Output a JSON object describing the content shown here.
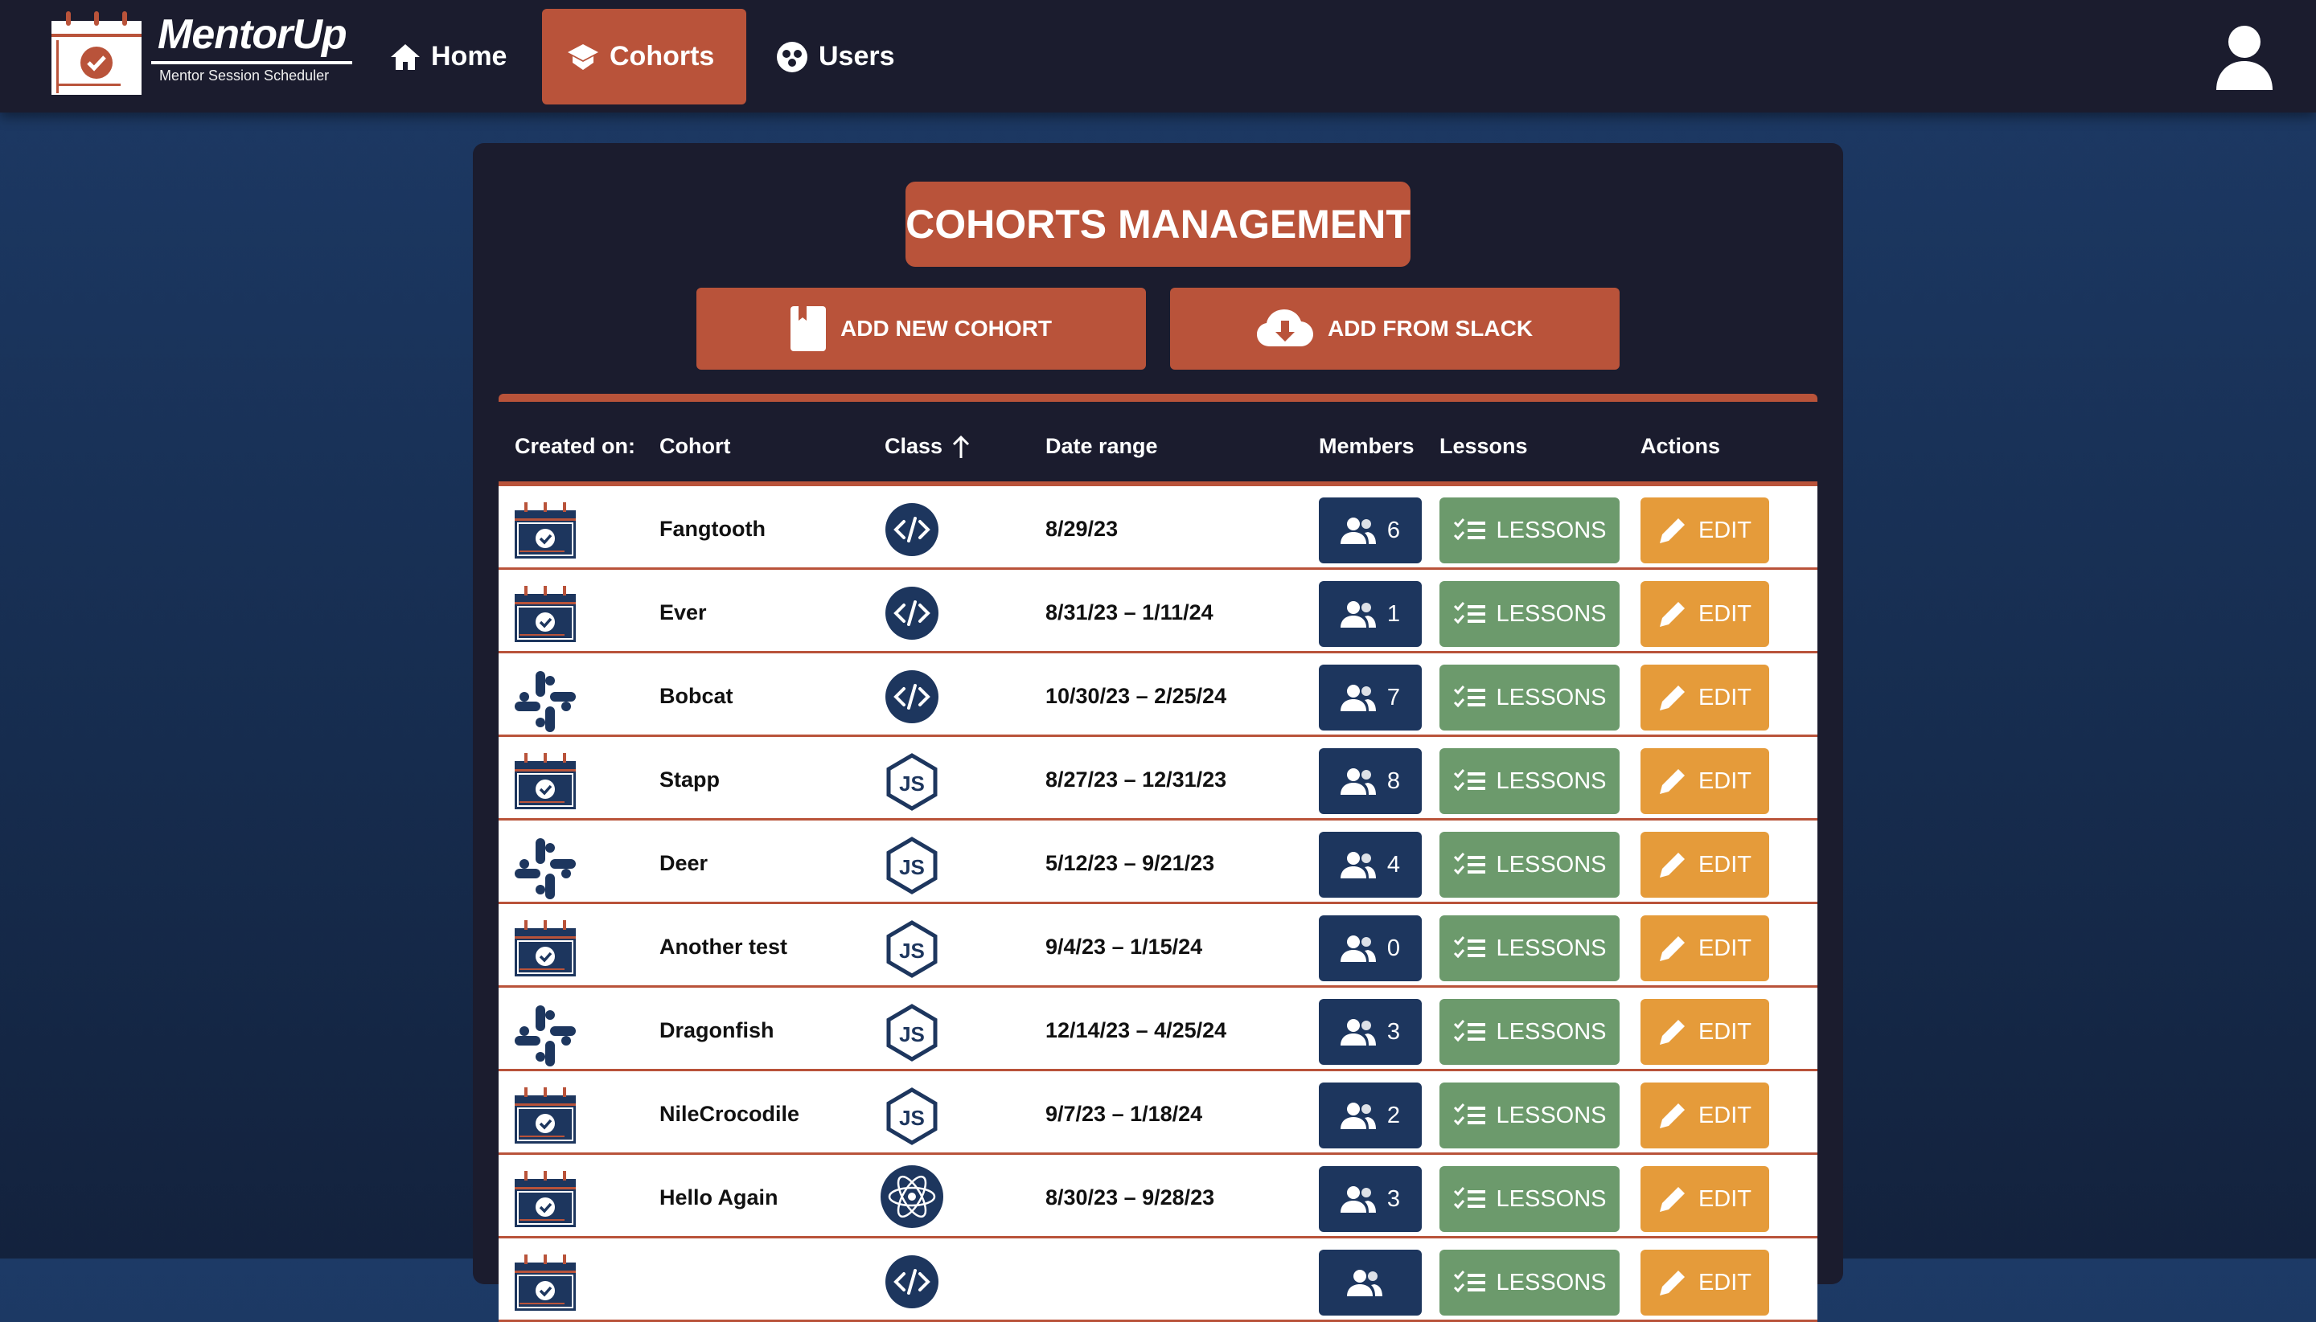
{
  "nav": {
    "brand": "MentorUp",
    "tagline": "Mentor Session Scheduler",
    "items": [
      {
        "label": "Home",
        "icon": "home-icon"
      },
      {
        "label": "Cohorts",
        "icon": "graduation-cap-icon",
        "active": true
      },
      {
        "label": "Users",
        "icon": "users-circle-icon"
      }
    ]
  },
  "page": {
    "title": "COHORTS MANAGEMENT",
    "add_new": "ADD NEW COHORT",
    "add_slack": "ADD FROM SLACK"
  },
  "table": {
    "headers": {
      "created": "Created on:",
      "cohort": "Cohort",
      "class": "Class",
      "date": "Date range",
      "members": "Members",
      "lessons": "Lessons",
      "actions": "Actions"
    },
    "sort": {
      "column": "Class",
      "direction": "ascending"
    },
    "lessons_label": "LESSONS",
    "edit_label": "EDIT",
    "rows": [
      {
        "source": "calendar",
        "name": "Fangtooth",
        "class": "code",
        "date": "8/29/23",
        "members": "6"
      },
      {
        "source": "calendar",
        "name": "Ever",
        "class": "code",
        "date": "8/31/23 – 1/11/24",
        "members": "1"
      },
      {
        "source": "slack",
        "name": "Bobcat",
        "class": "code",
        "date": "10/30/23 – 2/25/24",
        "members": "7"
      },
      {
        "source": "calendar",
        "name": "Stapp",
        "class": "node",
        "date": "8/27/23 – 12/31/23",
        "members": "8"
      },
      {
        "source": "slack",
        "name": "Deer",
        "class": "node",
        "date": "5/12/23 – 9/21/23",
        "members": "4"
      },
      {
        "source": "calendar",
        "name": "Another test",
        "class": "node",
        "date": "9/4/23 – 1/15/24",
        "members": "0"
      },
      {
        "source": "slack",
        "name": "Dragonfish",
        "class": "node",
        "date": "12/14/23 – 4/25/24",
        "members": "3"
      },
      {
        "source": "calendar",
        "name": "NileCrocodile",
        "class": "node",
        "date": "9/7/23 – 1/18/24",
        "members": "2"
      },
      {
        "source": "calendar",
        "name": "Hello Again",
        "class": "react",
        "date": "8/30/23 – 9/28/23",
        "members": "3"
      },
      {
        "source": "calendar",
        "name": "",
        "class": "code",
        "date": "",
        "members": ""
      }
    ]
  },
  "colors": {
    "nav": "#1b1c2e",
    "accent": "#b9533a",
    "navy": "#1d365e",
    "lessons": "#6c9a6c",
    "edit": "#e59b3a"
  }
}
